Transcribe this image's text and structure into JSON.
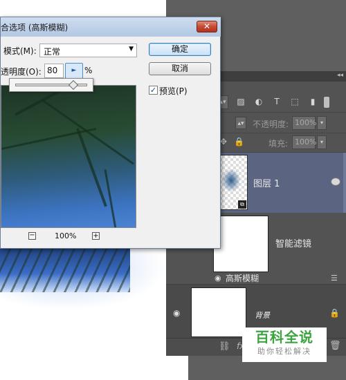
{
  "dialog": {
    "title": "合选项 (高斯模糊)",
    "close_symbol": "✕",
    "mode_label": "模式(M):",
    "mode_value": "正常",
    "opacity_label": "透明度(O):",
    "opacity_value": "80",
    "percent": "%",
    "opacity_slider_fraction": 0.8,
    "ok_label": "确定",
    "cancel_label": "取消",
    "preview_checked": true,
    "preview_label": "预览(P)",
    "zoom_out": "−",
    "zoom_level": "100%",
    "zoom_in": "+"
  },
  "layers_panel": {
    "collapse": "◂◂",
    "opacity_label": "不透明度:",
    "opacity_value": "100%",
    "fill_label": "填充:",
    "fill_value": "100%",
    "layer1_name": "图层 1",
    "smart_filters_label": "智能滤镜",
    "gaussian_blur_label": "高斯模糊",
    "background_name": "背景"
  },
  "watermark": {
    "title": "百科全说",
    "subtitle": "助你轻松解决"
  }
}
